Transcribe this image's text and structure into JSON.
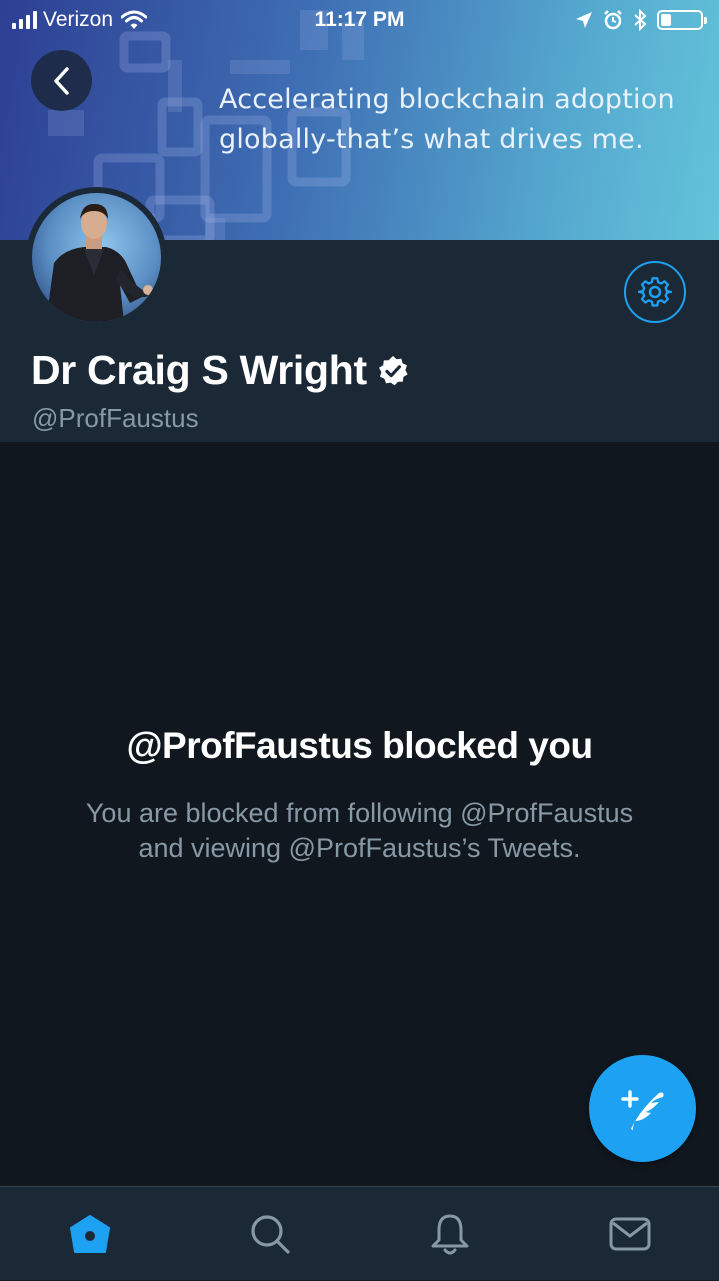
{
  "status_bar": {
    "carrier": "Verizon",
    "time": "11:17 PM",
    "battery_level": 0.25
  },
  "banner": {
    "quote": "Accelerating blockchain adoption globally-that’s what drives me."
  },
  "profile": {
    "display_name": "Dr Craig S Wright",
    "handle": "@ProfFaustus",
    "verified": true
  },
  "blocked": {
    "title": "@ProfFaustus blocked you",
    "message": "You are blocked from following @ProfFaustus and viewing @ProfFaustus’s Tweets."
  },
  "icons": {
    "back": "chevron-left-icon",
    "settings": "gear-icon",
    "verified": "verified-badge-icon",
    "compose": "compose-tweet-icon",
    "tabs": [
      "home-icon",
      "search-icon",
      "notifications-icon",
      "messages-icon"
    ]
  },
  "colors": {
    "accent": "#1da1f2",
    "background": "#10171e",
    "header": "#1b2836",
    "secondary_text": "#8899a6"
  }
}
